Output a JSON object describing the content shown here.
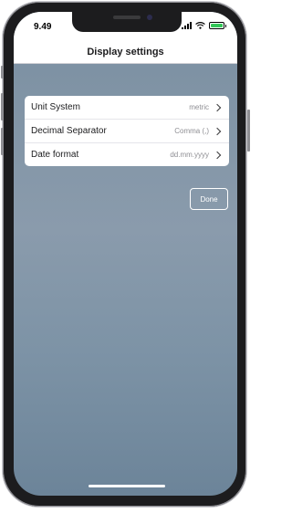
{
  "status_bar": {
    "time": "9.49",
    "signal_icon": "cellular-signal-icon",
    "wifi_icon": "wifi-icon",
    "battery_icon": "battery-charging-icon"
  },
  "nav": {
    "title": "Display settings"
  },
  "settings": [
    {
      "label": "Unit System",
      "value": "metric",
      "icon": "chevron-right-icon"
    },
    {
      "label": "Decimal Separator",
      "value": "Comma (,)",
      "icon": "chevron-right-icon"
    },
    {
      "label": "Date format",
      "value": "dd.mm.yyyy",
      "icon": "chevron-right-icon"
    }
  ],
  "actions": {
    "done_label": "Done"
  },
  "colors": {
    "background_top": "#7a8fa1",
    "background_bottom": "#6c8499",
    "card": "#ffffff",
    "battery_fill": "#34c759"
  }
}
